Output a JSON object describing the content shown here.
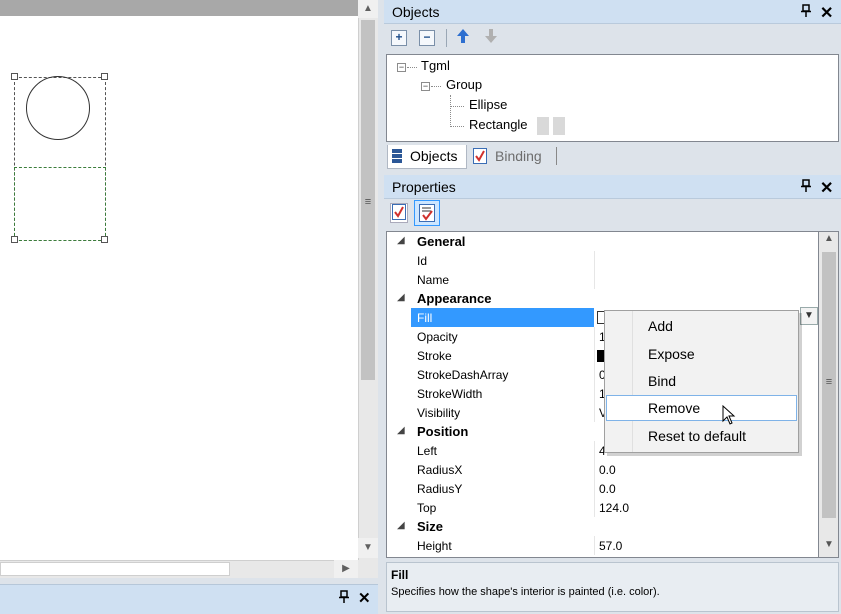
{
  "canvas": {
    "bottom_panel": {
      "pin_icon": "pin-icon",
      "close_icon": "close-icon"
    }
  },
  "objects_panel": {
    "title": "Objects",
    "toolbar": {
      "add": "+",
      "remove": "−",
      "up": "🡅",
      "down": "🡇"
    },
    "tree": {
      "root": "Tgml",
      "group": "Group",
      "children": [
        "Ellipse",
        "Rectangle"
      ]
    },
    "tabs": [
      {
        "label": "Objects",
        "active": true
      },
      {
        "label": "Binding",
        "active": false
      }
    ]
  },
  "properties_panel": {
    "title": "Properties",
    "categories": {
      "general": "General",
      "appearance": "Appearance",
      "position": "Position",
      "size": "Size"
    },
    "rows": {
      "id": {
        "label": "Id",
        "value": ""
      },
      "name": {
        "label": "Name",
        "value": ""
      },
      "fill": {
        "label": "Fill",
        "value": ""
      },
      "opacity": {
        "label": "Opacity",
        "value": "1"
      },
      "stroke": {
        "label": "Stroke",
        "value": ""
      },
      "strokedasharray": {
        "label": "StrokeDashArray",
        "value": "0"
      },
      "strokewidth": {
        "label": "StrokeWidth",
        "value": "1"
      },
      "visibility": {
        "label": "Visibility",
        "value": "V"
      },
      "left": {
        "label": "Left",
        "value": "4"
      },
      "radiusx": {
        "label": "RadiusX",
        "value": "0.0"
      },
      "radiusy": {
        "label": "RadiusY",
        "value": "0.0"
      },
      "top": {
        "label": "Top",
        "value": "124.0"
      },
      "height": {
        "label": "Height",
        "value": "57.0"
      }
    },
    "description": {
      "title": "Fill",
      "text": "Specifies how the shape's interior is painted (i.e. color)."
    }
  },
  "context_menu": {
    "items": [
      "Add",
      "Expose",
      "Bind",
      "Remove",
      "Reset to default"
    ],
    "hovered": "Remove"
  },
  "colors": {
    "accent": "#3399ff",
    "header": "#cfe0f2",
    "selected_hover": "#7fb3e8"
  }
}
